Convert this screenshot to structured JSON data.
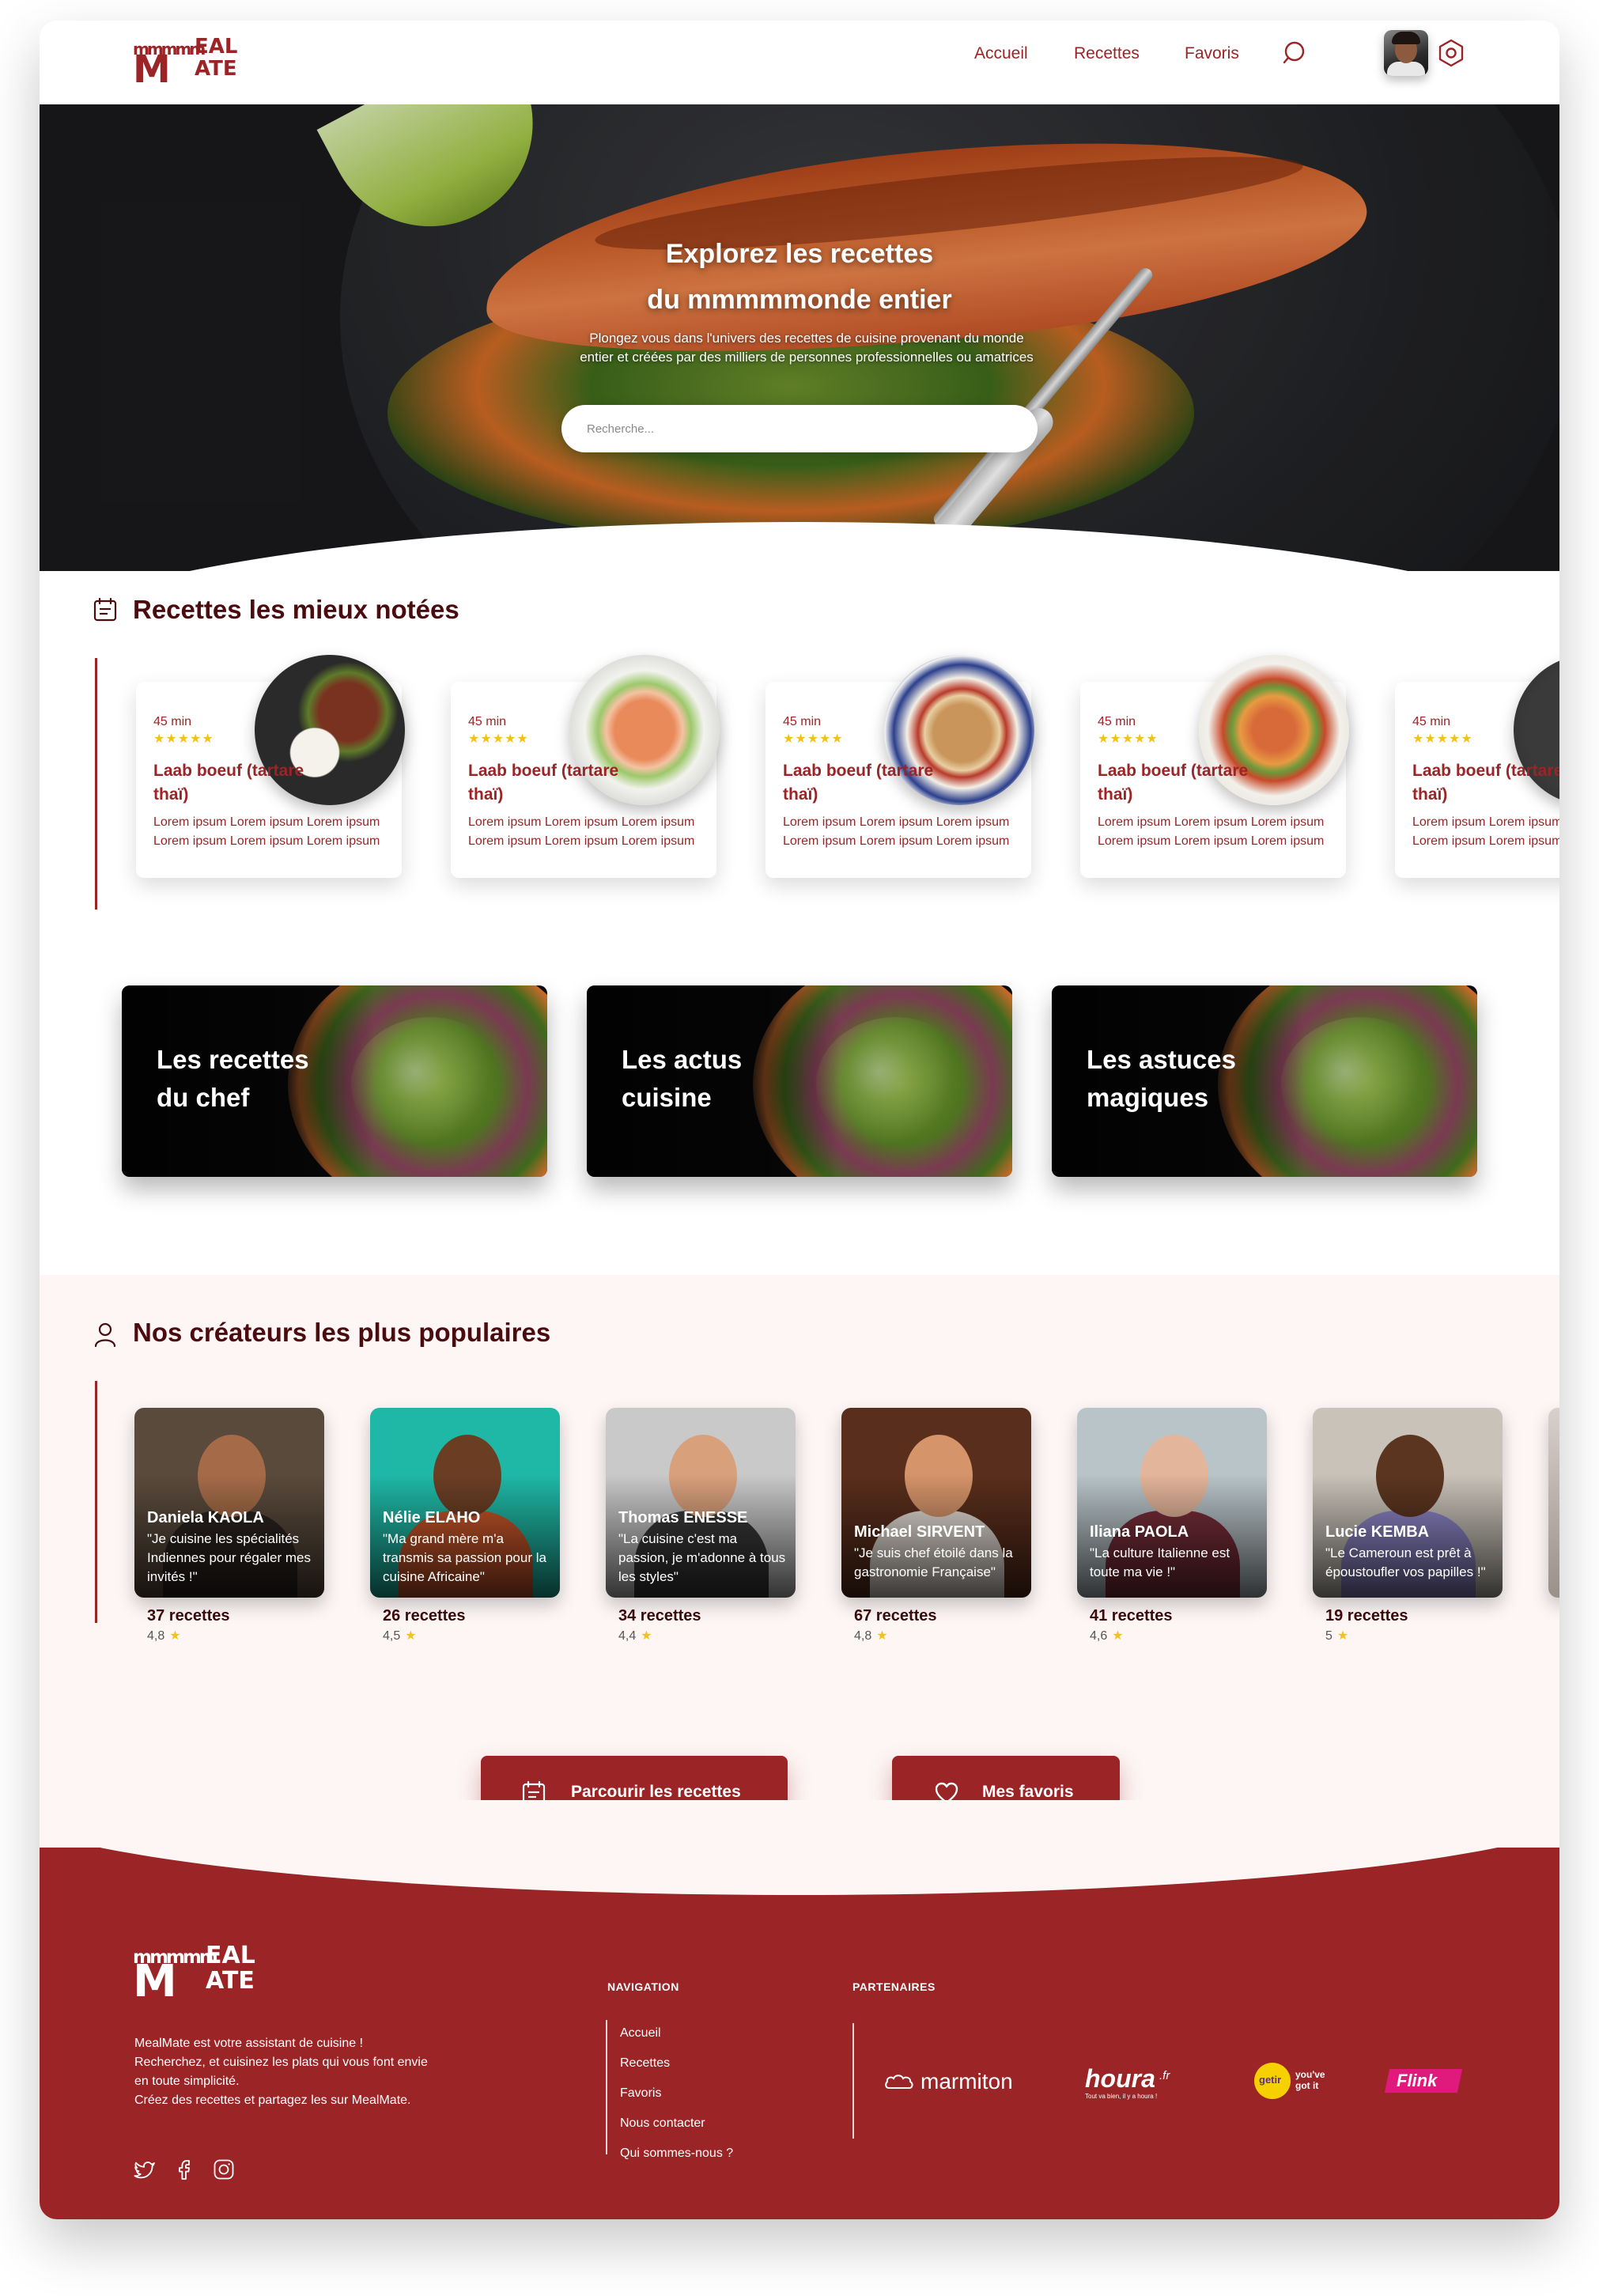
{
  "brand": {
    "logo_small": "mmmmm",
    "logo_m": "M",
    "logo_eal": "EAL",
    "logo_ate": "ATE",
    "color_primary": "#9b2426"
  },
  "nav": {
    "items": [
      "Accueil",
      "Recettes",
      "Favoris"
    ]
  },
  "hero": {
    "title_line1": "Explorez les recettes",
    "title_line2": "du mmmmmonde entier",
    "subtitle_line1": "Plongez vous dans l'univers des recettes de cuisine provenant du monde",
    "subtitle_line2": "entier et créées par des milliers de personnes professionnelles ou amatrices",
    "search_placeholder": "Recherche..."
  },
  "top_rated": {
    "title": "Recettes les mieux notées",
    "recipes": [
      {
        "time": "45 min",
        "rating": 5,
        "name": "Laab boeuf (tartare thaï)",
        "desc": "Lorem ipsum Lorem ipsum Lorem ipsum Lorem ipsum Lorem ipsum Lorem ipsum",
        "image": "dark-plate-beef-rice"
      },
      {
        "time": "45 min",
        "rating": 5,
        "name": "Laab boeuf (tartare thaï)",
        "desc": "Lorem ipsum Lorem ipsum Lorem ipsum Lorem ipsum Lorem ipsum Lorem ipsum",
        "image": "white-bowl-salmon"
      },
      {
        "time": "45 min",
        "rating": 5,
        "name": "Laab boeuf (tartare thaï)",
        "desc": "Lorem ipsum Lorem ipsum Lorem ipsum Lorem ipsum Lorem ipsum Lorem ipsum",
        "image": "blue-bowl-pho"
      },
      {
        "time": "45 min",
        "rating": 5,
        "name": "Laab boeuf (tartare thaï)",
        "desc": "Lorem ipsum Lorem ipsum Lorem ipsum Lorem ipsum Lorem ipsum Lorem ipsum",
        "image": "white-bowl-padthai"
      },
      {
        "time": "45 min",
        "rating": 5,
        "name": "Laab boeuf (tartare thaï)",
        "desc": "Lorem ipsum Lorem ipsum Lorem ipsum Lorem ipsum Lorem ipsum Lorem ipsum",
        "image": "dark-plate-partial"
      }
    ]
  },
  "categories": [
    {
      "line1": "Les recettes",
      "line2": "du chef"
    },
    {
      "line1": "Les actus",
      "line2": "cuisine"
    },
    {
      "line1": "Les astuces",
      "line2": "magiques"
    }
  ],
  "creators": {
    "title": "Nos créateurs les plus populaires",
    "items": [
      {
        "name": "Daniela KAOLA",
        "quote": "\"Je cuisine les spécialités Indiennes pour régaler mes invités !\"",
        "count": "37 recettes",
        "rating": "4,8",
        "bg": "#5a4a3c",
        "skin": "#a56b48",
        "cloth": "#2b2420"
      },
      {
        "name": "Nélie ELAHO",
        "quote": "\"Ma grand mère m'a transmis sa passion pour la cuisine Africaine\"",
        "count": "26 recettes",
        "rating": "4,5",
        "bg": "#1fb8a6",
        "skin": "#6b3e24",
        "cloth": "#c8562a"
      },
      {
        "name": "Thomas ENESSE",
        "quote": "\"La cuisine c'est ma passion, je m'adonne à tous les styles\"",
        "count": "34 recettes",
        "rating": "4,4",
        "bg": "#c9c9c9",
        "skin": "#d9a07c",
        "cloth": "#3a3a3a"
      },
      {
        "name": "Michael SIRVENT",
        "quote": "\"Je suis chef étoilé dans la gastronomie Française\"",
        "count": "67 recettes",
        "rating": "4,8",
        "bg": "#5a2e1c",
        "skin": "#d5946a",
        "cloth": "#e8e0d8"
      },
      {
        "name": "Iliana PAOLA",
        "quote": "\"La culture Italienne est toute ma vie !\"",
        "count": "41 recettes",
        "rating": "4,6",
        "bg": "#b8c4c8",
        "skin": "#e3b59a",
        "cloth": "#7a2e3a"
      },
      {
        "name": "Lucie KEMBA",
        "quote": "\"Le Cameroun est prêt à époustoufler vos papilles !\"",
        "count": "19 recettes",
        "rating": "5",
        "bg": "#c8c2b8",
        "skin": "#5c3520",
        "cloth": "#8e86c8"
      }
    ]
  },
  "cta": {
    "browse_label": "Parcourir les recettes",
    "favorites_label": "Mes favoris"
  },
  "footer": {
    "desc": [
      "MealMate est votre assistant de cuisine !",
      "Recherchez, et cuisinez les plats qui vous font envie",
      "en toute simplicité.",
      "Créez des recettes et partagez les sur MealMate."
    ],
    "nav_heading": "NAVIGATION",
    "nav_links": [
      "Accueil",
      "Recettes",
      "Favoris",
      "Nous contacter",
      "Qui sommes-nous ?"
    ],
    "partners_heading": "PARTENAIRES",
    "partners": {
      "marmiton": "marmiton",
      "houra": "houra",
      "houra_tld": ".fr",
      "houra_tagline": "Tout va bien, il y a houra !",
      "getir": "getir",
      "getir_tagline_1": "you've",
      "getir_tagline_2": "got it",
      "flink": "Flink"
    }
  }
}
